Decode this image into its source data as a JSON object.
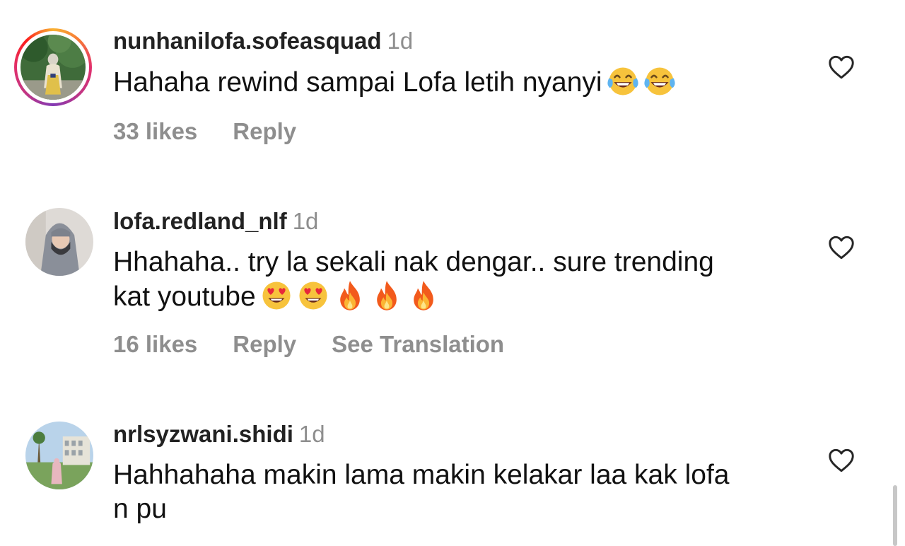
{
  "comments": [
    {
      "username": "nunhanilofa.sofeasquad",
      "time": "1d",
      "text": "Hahaha rewind sampai Lofa letih nyanyi",
      "emojis": [
        "face-with-tears-of-joy",
        "face-with-tears-of-joy"
      ],
      "likes": "33 likes",
      "reply": "Reply",
      "has_story_ring": true
    },
    {
      "username": "lofa.redland_nlf",
      "time": "1d",
      "text_line1": "Hhahaha.. try la sekali nak dengar.. sure trending",
      "text_line2": "kat youtube",
      "emojis": [
        "smiling-face-with-heart-eyes",
        "smiling-face-with-heart-eyes",
        "fire",
        "fire",
        "fire"
      ],
      "likes": "16 likes",
      "reply": "Reply",
      "translation": "See Translation",
      "has_story_ring": false
    },
    {
      "username": "nrlsyzwani.shidi",
      "time": "1d",
      "text_line1": "Hahhahaha makin lama makin kelakar laa kak lofa",
      "text_line2": "n pu",
      "has_story_ring": false
    }
  ],
  "icons": {
    "like": "heart-outline-icon"
  },
  "colors": {
    "secondary_text": "#8e8e8e",
    "primary_text": "#111111",
    "username": "#222222"
  }
}
